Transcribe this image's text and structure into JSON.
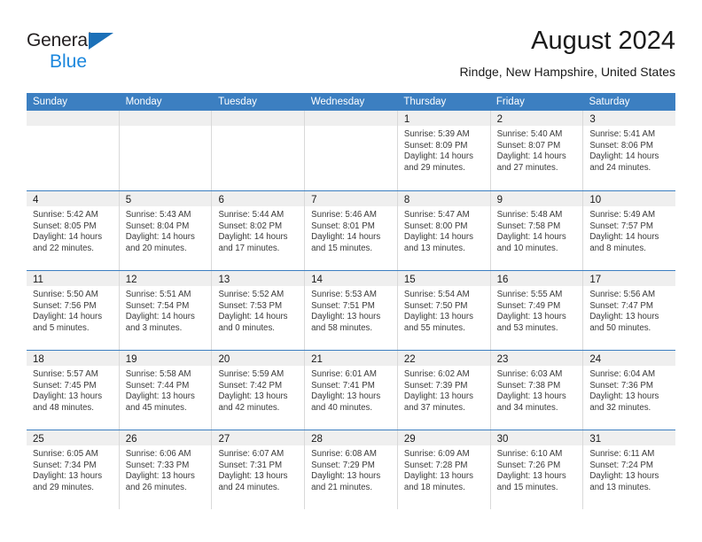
{
  "brand": {
    "name_line1": "General",
    "name_line2": "Blue",
    "accent_color": "#1b70b8",
    "accent_color_light": "#1b87dd"
  },
  "header": {
    "title": "August 2024",
    "subtitle": "Rindge, New Hampshire, United States"
  },
  "theme": {
    "header_blue": "#3c7fc1",
    "day_band_gray": "#efefef",
    "grid_line": "#d9d9d9",
    "text": "#1a1a1a"
  },
  "weekdays": [
    "Sunday",
    "Monday",
    "Tuesday",
    "Wednesday",
    "Thursday",
    "Friday",
    "Saturday"
  ],
  "weeks": [
    [
      {
        "day": "",
        "lines": []
      },
      {
        "day": "",
        "lines": []
      },
      {
        "day": "",
        "lines": []
      },
      {
        "day": "",
        "lines": []
      },
      {
        "day": "1",
        "lines": [
          "Sunrise: 5:39 AM",
          "Sunset: 8:09 PM",
          "Daylight: 14 hours",
          "and 29 minutes."
        ]
      },
      {
        "day": "2",
        "lines": [
          "Sunrise: 5:40 AM",
          "Sunset: 8:07 PM",
          "Daylight: 14 hours",
          "and 27 minutes."
        ]
      },
      {
        "day": "3",
        "lines": [
          "Sunrise: 5:41 AM",
          "Sunset: 8:06 PM",
          "Daylight: 14 hours",
          "and 24 minutes."
        ]
      }
    ],
    [
      {
        "day": "4",
        "lines": [
          "Sunrise: 5:42 AM",
          "Sunset: 8:05 PM",
          "Daylight: 14 hours",
          "and 22 minutes."
        ]
      },
      {
        "day": "5",
        "lines": [
          "Sunrise: 5:43 AM",
          "Sunset: 8:04 PM",
          "Daylight: 14 hours",
          "and 20 minutes."
        ]
      },
      {
        "day": "6",
        "lines": [
          "Sunrise: 5:44 AM",
          "Sunset: 8:02 PM",
          "Daylight: 14 hours",
          "and 17 minutes."
        ]
      },
      {
        "day": "7",
        "lines": [
          "Sunrise: 5:46 AM",
          "Sunset: 8:01 PM",
          "Daylight: 14 hours",
          "and 15 minutes."
        ]
      },
      {
        "day": "8",
        "lines": [
          "Sunrise: 5:47 AM",
          "Sunset: 8:00 PM",
          "Daylight: 14 hours",
          "and 13 minutes."
        ]
      },
      {
        "day": "9",
        "lines": [
          "Sunrise: 5:48 AM",
          "Sunset: 7:58 PM",
          "Daylight: 14 hours",
          "and 10 minutes."
        ]
      },
      {
        "day": "10",
        "lines": [
          "Sunrise: 5:49 AM",
          "Sunset: 7:57 PM",
          "Daylight: 14 hours",
          "and 8 minutes."
        ]
      }
    ],
    [
      {
        "day": "11",
        "lines": [
          "Sunrise: 5:50 AM",
          "Sunset: 7:56 PM",
          "Daylight: 14 hours",
          "and 5 minutes."
        ]
      },
      {
        "day": "12",
        "lines": [
          "Sunrise: 5:51 AM",
          "Sunset: 7:54 PM",
          "Daylight: 14 hours",
          "and 3 minutes."
        ]
      },
      {
        "day": "13",
        "lines": [
          "Sunrise: 5:52 AM",
          "Sunset: 7:53 PM",
          "Daylight: 14 hours",
          "and 0 minutes."
        ]
      },
      {
        "day": "14",
        "lines": [
          "Sunrise: 5:53 AM",
          "Sunset: 7:51 PM",
          "Daylight: 13 hours",
          "and 58 minutes."
        ]
      },
      {
        "day": "15",
        "lines": [
          "Sunrise: 5:54 AM",
          "Sunset: 7:50 PM",
          "Daylight: 13 hours",
          "and 55 minutes."
        ]
      },
      {
        "day": "16",
        "lines": [
          "Sunrise: 5:55 AM",
          "Sunset: 7:49 PM",
          "Daylight: 13 hours",
          "and 53 minutes."
        ]
      },
      {
        "day": "17",
        "lines": [
          "Sunrise: 5:56 AM",
          "Sunset: 7:47 PM",
          "Daylight: 13 hours",
          "and 50 minutes."
        ]
      }
    ],
    [
      {
        "day": "18",
        "lines": [
          "Sunrise: 5:57 AM",
          "Sunset: 7:45 PM",
          "Daylight: 13 hours",
          "and 48 minutes."
        ]
      },
      {
        "day": "19",
        "lines": [
          "Sunrise: 5:58 AM",
          "Sunset: 7:44 PM",
          "Daylight: 13 hours",
          "and 45 minutes."
        ]
      },
      {
        "day": "20",
        "lines": [
          "Sunrise: 5:59 AM",
          "Sunset: 7:42 PM",
          "Daylight: 13 hours",
          "and 42 minutes."
        ]
      },
      {
        "day": "21",
        "lines": [
          "Sunrise: 6:01 AM",
          "Sunset: 7:41 PM",
          "Daylight: 13 hours",
          "and 40 minutes."
        ]
      },
      {
        "day": "22",
        "lines": [
          "Sunrise: 6:02 AM",
          "Sunset: 7:39 PM",
          "Daylight: 13 hours",
          "and 37 minutes."
        ]
      },
      {
        "day": "23",
        "lines": [
          "Sunrise: 6:03 AM",
          "Sunset: 7:38 PM",
          "Daylight: 13 hours",
          "and 34 minutes."
        ]
      },
      {
        "day": "24",
        "lines": [
          "Sunrise: 6:04 AM",
          "Sunset: 7:36 PM",
          "Daylight: 13 hours",
          "and 32 minutes."
        ]
      }
    ],
    [
      {
        "day": "25",
        "lines": [
          "Sunrise: 6:05 AM",
          "Sunset: 7:34 PM",
          "Daylight: 13 hours",
          "and 29 minutes."
        ]
      },
      {
        "day": "26",
        "lines": [
          "Sunrise: 6:06 AM",
          "Sunset: 7:33 PM",
          "Daylight: 13 hours",
          "and 26 minutes."
        ]
      },
      {
        "day": "27",
        "lines": [
          "Sunrise: 6:07 AM",
          "Sunset: 7:31 PM",
          "Daylight: 13 hours",
          "and 24 minutes."
        ]
      },
      {
        "day": "28",
        "lines": [
          "Sunrise: 6:08 AM",
          "Sunset: 7:29 PM",
          "Daylight: 13 hours",
          "and 21 minutes."
        ]
      },
      {
        "day": "29",
        "lines": [
          "Sunrise: 6:09 AM",
          "Sunset: 7:28 PM",
          "Daylight: 13 hours",
          "and 18 minutes."
        ]
      },
      {
        "day": "30",
        "lines": [
          "Sunrise: 6:10 AM",
          "Sunset: 7:26 PM",
          "Daylight: 13 hours",
          "and 15 minutes."
        ]
      },
      {
        "day": "31",
        "lines": [
          "Sunrise: 6:11 AM",
          "Sunset: 7:24 PM",
          "Daylight: 13 hours",
          "and 13 minutes."
        ]
      }
    ]
  ]
}
